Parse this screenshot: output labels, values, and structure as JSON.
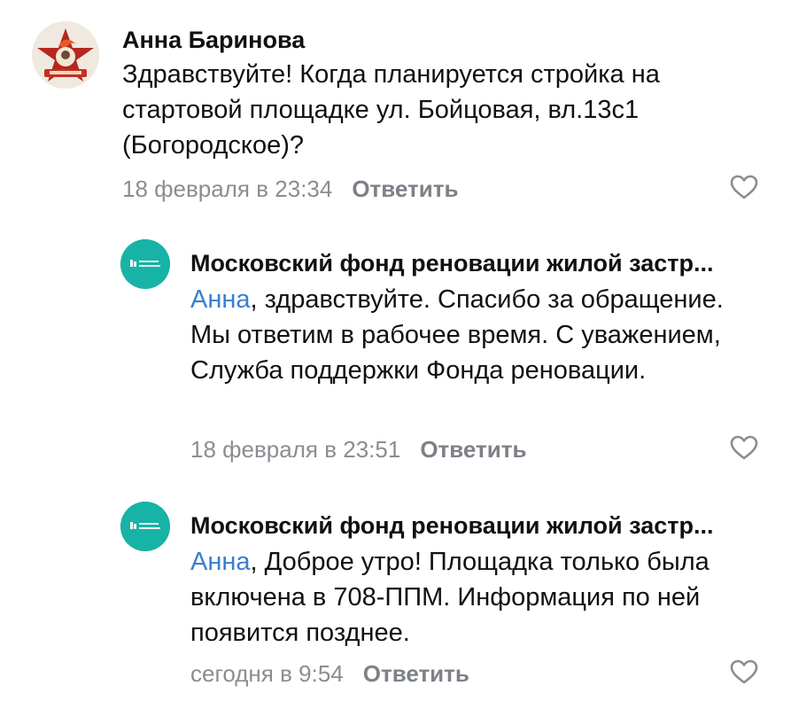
{
  "comments": [
    {
      "author": "Анна Баринова",
      "text": "Здравствуйте! Когда планируется стройка на стартовой площадке ул. Бойцовая, вл.13с1 (Богородское)?",
      "time": "18 февраля в 23:34",
      "reply_label": "Ответить"
    },
    {
      "author": "Московский фонд реновации жилой застр...",
      "mention": "Анна",
      "text": ", здравствуйте. Спасибо за обращение. Мы ответим в рабочее время. С уважением, Служба поддержки Фонда реновации.",
      "time": "18 февраля в 23:51",
      "reply_label": "Ответить"
    },
    {
      "author": "Московский фонд реновации жилой застр...",
      "mention": "Анна",
      "text": ", Доброе утро! Площадка только была включена в 708-ППМ. Информация по ней появится позднее.",
      "time": "сегодня в 9:54",
      "reply_label": "Ответить"
    }
  ],
  "colors": {
    "mention": "#3a7fd1",
    "meta": "#8a8d91",
    "fund_avatar": "#17b3a6"
  },
  "icons": {
    "like": "heart-outline-icon",
    "user_avatar": "pioneer-badge-avatar",
    "fund_avatar": "fund-logo-avatar"
  }
}
